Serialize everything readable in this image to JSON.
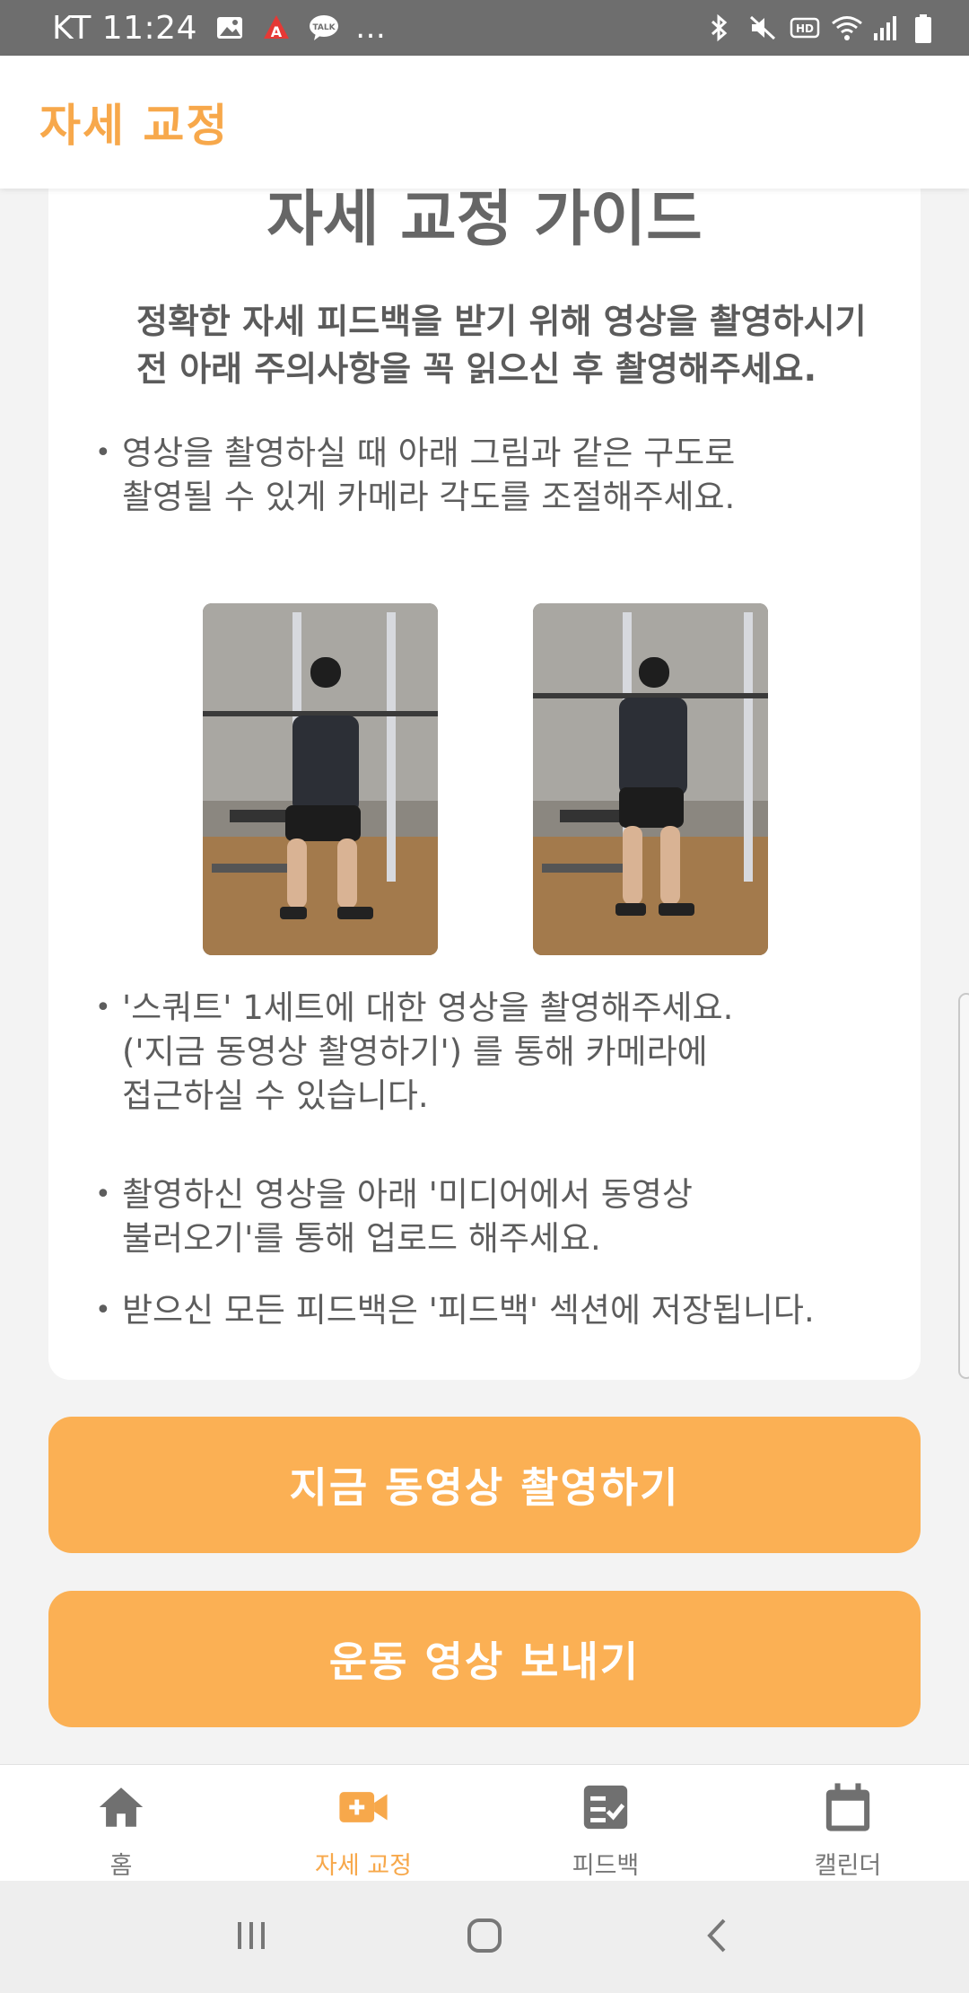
{
  "status_bar": {
    "carrier_time": "KT 11:24",
    "more": "…"
  },
  "app_bar": {
    "title": "자세 교정"
  },
  "guide": {
    "title": "자세 교정 가이드",
    "intro": "정확한 자세 피드백을 받기 위해 영상을 촬영하시기 전 아래 주의사항을 꼭 읽으신 후 촬영해주세요.",
    "bullets": [
      "영상을 촬영하실 때 아래 그림과 같은 구도로\n촬영될 수 있게 카메라 각도를 조절해주세요.",
      "'스쿼트' 1세트에 대한 영상을 촬영해주세요.\n('지금 동영상 촬영하기') 를 통해 카메라에\n접근하실 수 있습니다.",
      "촬영하신 영상을 아래 '미디어에서 동영상\n불러오기'를 통해 업로드 해주세요.",
      "받으신 모든 피드백은 '피드백' 섹션에 저장됩니다."
    ],
    "bullet_mark": "•"
  },
  "buttons": {
    "record": "지금 동영상 촬영하기",
    "send": "운동 영상 보내기"
  },
  "bottom_nav": [
    {
      "label": "홈",
      "icon": "home-icon",
      "active": false
    },
    {
      "label": "자세 교정",
      "icon": "video-add-icon",
      "active": true
    },
    {
      "label": "피드백",
      "icon": "checklist-icon",
      "active": false
    },
    {
      "label": "캘린더",
      "icon": "calendar-icon",
      "active": false
    }
  ],
  "colors": {
    "accent": "#f7a84b",
    "button": "#fbb054",
    "status_bar": "#6e6e6e"
  }
}
